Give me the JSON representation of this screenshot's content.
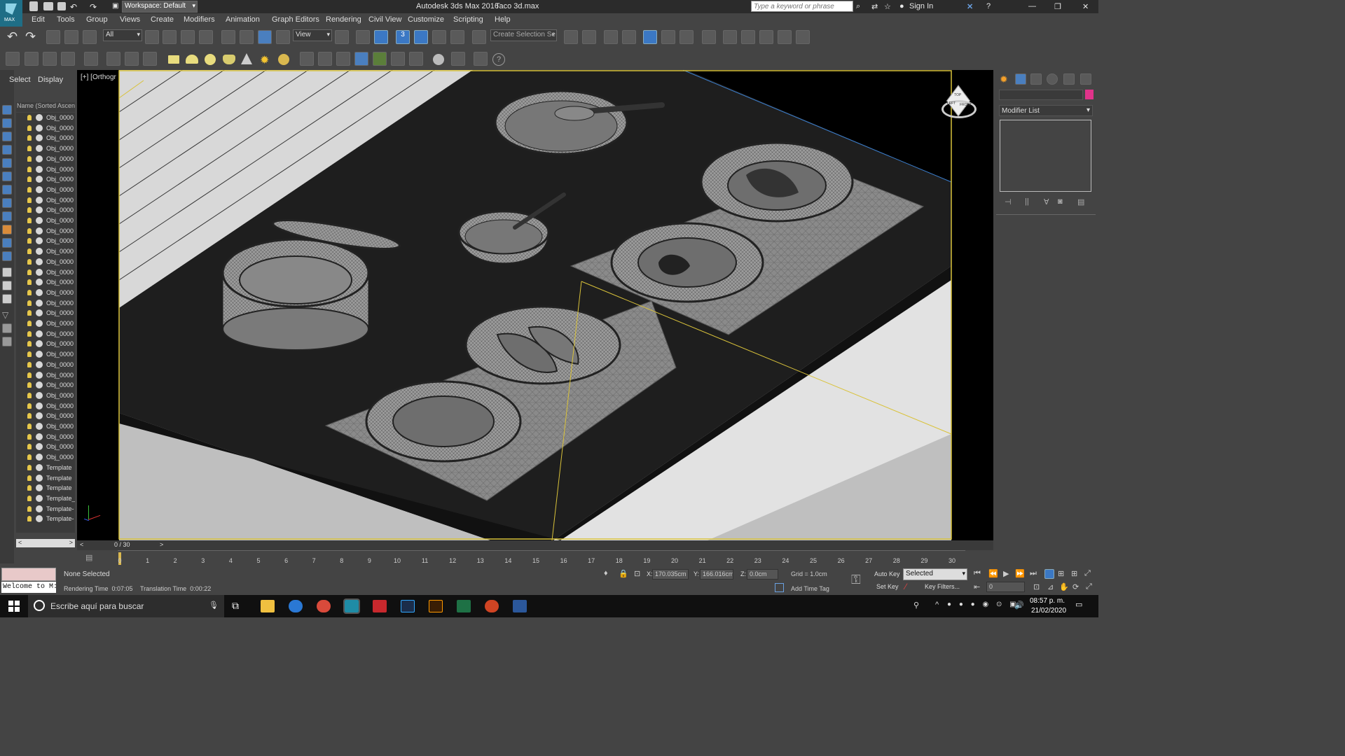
{
  "titlebar": {
    "app_title": "Autodesk 3ds Max 2016",
    "file_name": "Taco 3d.max",
    "workspace": "Workspace: Default",
    "search_placeholder": "Type a keyword or phrase",
    "sign_in": "Sign In",
    "logo": "MAX"
  },
  "menu": [
    "Edit",
    "Tools",
    "Group",
    "Views",
    "Create",
    "Modifiers",
    "Animation",
    "Graph Editors",
    "Rendering",
    "Civil View",
    "Customize",
    "Scripting",
    "Help"
  ],
  "toolbar": {
    "filter_value": "All",
    "ref_coord_value": "View",
    "selection_set_placeholder": "Create Selection Se",
    "snap_label": "3"
  },
  "scene_explorer": {
    "tabs": [
      "Select",
      "Display"
    ],
    "column_header": "Name (Sorted Ascen",
    "items": [
      "Obj_0000",
      "Obj_0000",
      "Obj_0000",
      "Obj_0000",
      "Obj_0000",
      "Obj_0000",
      "Obj_0000",
      "Obj_0000",
      "Obj_0000",
      "Obj_0000",
      "Obj_0000",
      "Obj_0000",
      "Obj_0000",
      "Obj_0000",
      "Obj_0000",
      "Obj_0000",
      "Obj_0000",
      "Obj_0000",
      "Obj_0000",
      "Obj_0000",
      "Obj_0000",
      "Obj_0000",
      "Obj_0000",
      "Obj_0000",
      "Obj_0000",
      "Obj_0000",
      "Obj_0000",
      "Obj_0000",
      "Obj_0000",
      "Obj_0000",
      "Obj_0000",
      "Obj_0000",
      "Obj_0000",
      "Obj_0000",
      "Template",
      "Template",
      "Template",
      "Template_",
      "Template-",
      "Template-"
    ]
  },
  "viewport": {
    "label": "[+] [Orthogr",
    "viewcube_labels": [
      "LEFT",
      "FRONT",
      "TOP"
    ]
  },
  "command_panel": {
    "modifier_list": "Modifier List"
  },
  "timeline": {
    "slider_label": "0 / 30",
    "ticks": [
      "0",
      "1",
      "2",
      "3",
      "4",
      "5",
      "6",
      "7",
      "8",
      "9",
      "10",
      "11",
      "12",
      "13",
      "14",
      "15",
      "16",
      "17",
      "18",
      "19",
      "20",
      "21",
      "22",
      "23",
      "24",
      "25",
      "26",
      "27",
      "28",
      "29",
      "30"
    ]
  },
  "status": {
    "maxscript": "Welcome to M:",
    "selection": "None Selected",
    "rendering_time": "Rendering Time  0:07:05",
    "translation_time": "Translation Time  0:00:22",
    "x_label": "X:",
    "x_value": "170.035cm",
    "y_label": "Y:",
    "y_value": "166.016cm",
    "z_label": "Z:",
    "z_value": "0.0cm",
    "grid": "Grid = 1.0cm",
    "add_time_tag": "Add Time Tag",
    "auto_key": "Auto Key",
    "set_key": "Set Key",
    "key_mode": "Selected",
    "key_filters": "Key Filters...",
    "frame": "0"
  },
  "taskbar": {
    "search_placeholder": "Escribe aquí para buscar",
    "time": "08:57 p. m.",
    "date": "21/02/2020"
  }
}
